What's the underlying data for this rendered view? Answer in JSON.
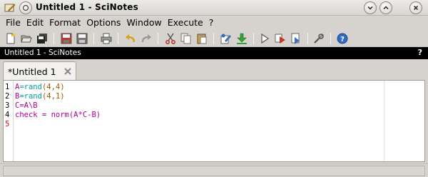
{
  "window": {
    "title": "Untitled 1 - SciNotes"
  },
  "menubar": {
    "items": [
      {
        "label": "File",
        "name": "menu-file"
      },
      {
        "label": "Edit",
        "name": "menu-edit"
      },
      {
        "label": "Format",
        "name": "menu-format"
      },
      {
        "label": "Options",
        "name": "menu-options"
      },
      {
        "label": "Window",
        "name": "menu-window"
      },
      {
        "label": "Execute",
        "name": "menu-execute"
      },
      {
        "label": "?",
        "name": "menu-help"
      }
    ]
  },
  "toolbar": {
    "tools": [
      "new-file-icon",
      "open-folder-icon",
      "save-all-icon",
      "save-icon",
      "save-as-icon",
      "print-icon",
      "undo-icon",
      "redo-icon",
      "cut-icon",
      "copy-icon",
      "paste-icon",
      "edit-icon",
      "download-icon",
      "execute-icon",
      "execute-with-echo-icon",
      "execute-file-icon",
      "settings-icon",
      "help-icon"
    ]
  },
  "panel": {
    "title": "Untitled 1 - SciNotes",
    "help_label": "?"
  },
  "tabs": [
    {
      "label": "*Untitled 1"
    }
  ],
  "editor": {
    "line_numbers": [
      "1",
      "2",
      "3",
      "4",
      "5"
    ],
    "current_line": "5",
    "lines": [
      {
        "var": "A",
        "op": "=",
        "fn": "rand",
        "args": "(4,4)"
      },
      {
        "var": "B",
        "op": "=",
        "fn": "rand",
        "args": "(4,1)"
      },
      {
        "text": "C=A\\B"
      },
      {
        "text": "check = norm(A*C-B)"
      },
      {
        "text": ""
      }
    ]
  },
  "colors": {
    "variable": "#b40096",
    "function": "#00a0a0",
    "number": "#a05a00",
    "current_line_number": "#ff0000"
  }
}
